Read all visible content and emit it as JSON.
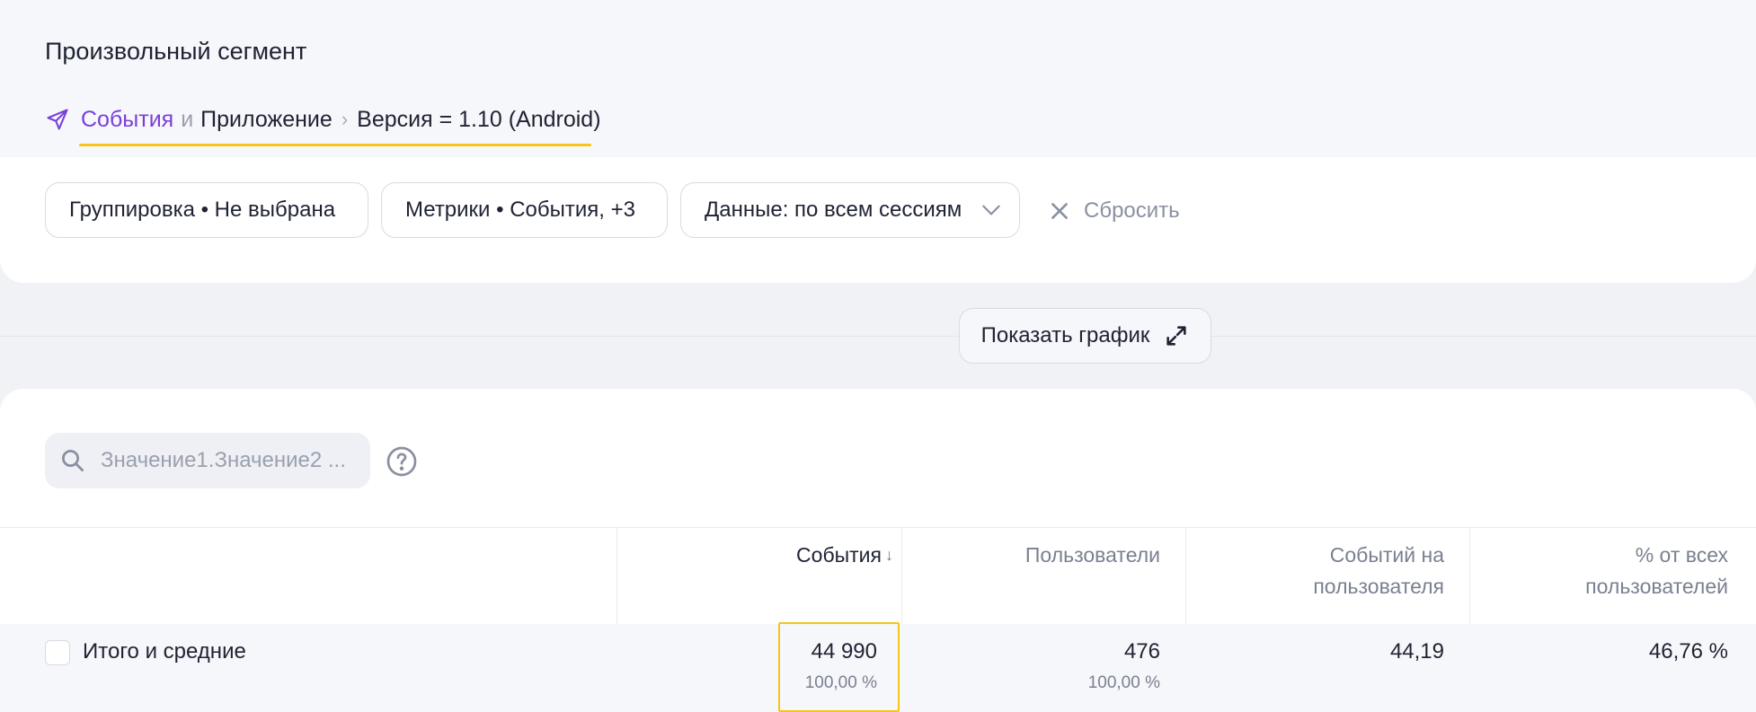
{
  "header": {
    "title": "Произвольный сегмент",
    "breadcrumb": {
      "events": "События",
      "and": "и",
      "app": "Приложение",
      "separator": "›",
      "version": "Версия = 1.10 (Android)"
    }
  },
  "filters": {
    "grouping": "Группировка • Не выбрана",
    "metrics": "Метрики • События, +3",
    "data": "Данные: по всем сессиям",
    "reset": "Сбросить"
  },
  "chart_toggle": {
    "label": "Показать график"
  },
  "search": {
    "placeholder": "Значение1.Значение2 ..."
  },
  "table": {
    "columns": [
      {
        "line1": "События",
        "line2": ""
      },
      {
        "line1": "Пользователи",
        "line2": ""
      },
      {
        "line1": "Событий на",
        "line2": "пользователя"
      },
      {
        "line1": "% от всех",
        "line2": "пользователей"
      }
    ],
    "sort_indicator": "↓",
    "total": {
      "label": "Итого и средние",
      "events": "44 990",
      "events_share": "100,00 %",
      "users": "476",
      "users_share": "100,00 %",
      "events_per_user": "44,19",
      "percent_of_all_users": "46,76 %"
    }
  },
  "colors": {
    "accent": "#7a3fdb",
    "highlight": "#f5c518",
    "muted_text": "#7a8090"
  }
}
